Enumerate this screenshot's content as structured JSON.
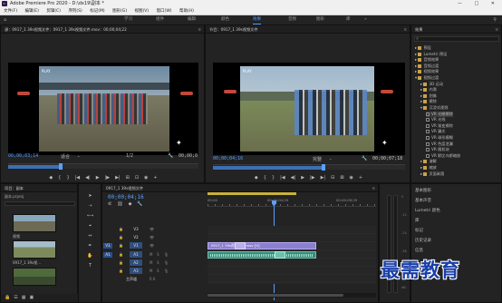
{
  "window": {
    "title": "Adobe Premiere Pro 2020 - D:\\dx19\\副本 *",
    "app_icon_text": "Pr",
    "controls": "— □ ✕"
  },
  "menu": [
    "文件(F)",
    "编辑(E)",
    "剪辑(C)",
    "序列(S)",
    "标记(M)",
    "图形(G)",
    "视图(V)",
    "窗口(W)",
    "帮助(H)"
  ],
  "workspaces": {
    "items": [
      "学习",
      "组件",
      "编辑",
      "颜色",
      "效果",
      "音频",
      "图形",
      "库"
    ],
    "active": "效果",
    "more": "»"
  },
  "source_monitor": {
    "tab": "源：0917_1 39s视频文件：0917_1 39s视频文件.mov：00;00;04;22",
    "menu_glyph": "≡",
    "timecode": "00;00;03;14",
    "fit": "适合",
    "fraction": "1/2",
    "duration": "00;00;0",
    "clip_label": "PLAY"
  },
  "program_monitor": {
    "tab": "节目：0917_1 39s视频文件",
    "menu_glyph": "≡",
    "timecode": "00;00;04;16",
    "fit": "完整",
    "duration": "00;00;07;18",
    "clip_label": "PLAY"
  },
  "effects_panel": {
    "tab": "效果",
    "menu_glyph": "≡",
    "items": [
      {
        "label": "预设",
        "kind": "folder",
        "indent": 0
      },
      {
        "label": "Lumetri 预设",
        "kind": "folder",
        "indent": 0
      },
      {
        "label": "音频效果",
        "kind": "folder",
        "indent": 0
      },
      {
        "label": "音频过渡",
        "kind": "folder",
        "indent": 0
      },
      {
        "label": "视频效果",
        "kind": "folder",
        "indent": 0
      },
      {
        "label": "视频过渡",
        "kind": "folder",
        "indent": 0
      },
      {
        "label": "3D 运动",
        "kind": "folder",
        "indent": 1
      },
      {
        "label": "内滑",
        "kind": "folder",
        "indent": 1
      },
      {
        "label": "划像",
        "kind": "folder",
        "indent": 1
      },
      {
        "label": "擦除",
        "kind": "folder",
        "indent": 1
      },
      {
        "label": "沉浸式视频",
        "kind": "folder",
        "indent": 1
      },
      {
        "label": "VR 光圈擦除",
        "kind": "fx",
        "indent": 2,
        "selected": true
      },
      {
        "label": "VR 光线",
        "kind": "fx",
        "indent": 2
      },
      {
        "label": "VR 渐变擦除",
        "kind": "fx",
        "indent": 2
      },
      {
        "label": "VR 漏光",
        "kind": "fx",
        "indent": 2
      },
      {
        "label": "VR 球形模糊",
        "kind": "fx",
        "indent": 2
      },
      {
        "label": "VR 色度泄漏",
        "kind": "fx",
        "indent": 2
      },
      {
        "label": "VR 随机块",
        "kind": "fx",
        "indent": 2
      },
      {
        "label": "VR 默比乌斯缩放",
        "kind": "fx",
        "indent": 2
      },
      {
        "label": "溶解",
        "kind": "folder",
        "indent": 1
      },
      {
        "label": "缩放",
        "kind": "folder",
        "indent": 1
      },
      {
        "label": "页面剥落",
        "kind": "folder",
        "indent": 1
      }
    ]
  },
  "side_panels": [
    "基本图形",
    "基本声音",
    "Lumetri 颜色",
    "库",
    "标记",
    "历史记录",
    "信息"
  ],
  "project_panel": {
    "tab": "项目：副本",
    "file": "副本.prproj",
    "items": [
      {
        "label": "视频"
      },
      {
        "label": "0917_1 39s视..."
      },
      {
        "label": ""
      }
    ]
  },
  "timeline": {
    "tab": "0917_1 39s视频文件",
    "menu_glyph": "≡",
    "timecode": "00;00;04;16",
    "ruler": [
      "00;00",
      "00;00;04;29",
      "00;00;09;29"
    ],
    "tracks": [
      {
        "target": "",
        "name": "V3",
        "type": "video"
      },
      {
        "target": "",
        "name": "V2",
        "type": "video"
      },
      {
        "target": "V1",
        "name": "V1",
        "type": "video"
      },
      {
        "target": "A1",
        "name": "A1",
        "type": "audio"
      },
      {
        "target": "",
        "name": "A2",
        "type": "audio"
      },
      {
        "target": "",
        "name": "A3",
        "type": "audio"
      },
      {
        "target": "",
        "name": "主声道",
        "type": "master",
        "value": "0.0"
      }
    ],
    "video_clip_label": "0917_1 39s视频文件.mov [V]",
    "audio_clip_label": "",
    "meter_scale": [
      "0",
      "-12",
      "-24",
      "-36",
      "-48",
      "dB"
    ]
  },
  "watermark": "最需教育"
}
